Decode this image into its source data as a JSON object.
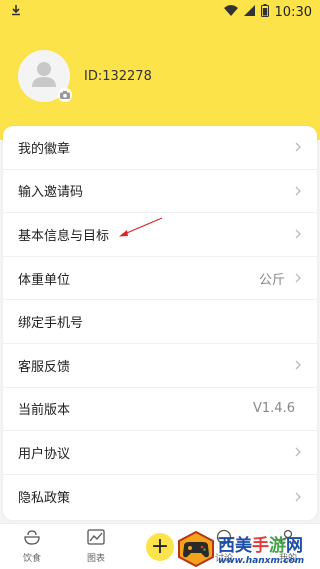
{
  "colors": {
    "accent": "#fce34a",
    "annotation": "#d9262c"
  },
  "status_bar": {
    "time": "10:30"
  },
  "profile": {
    "id_text": "ID:132278"
  },
  "menu": [
    {
      "label": "我的徽章",
      "value": ""
    },
    {
      "label": "输入邀请码",
      "value": ""
    },
    {
      "label": "基本信息与目标",
      "value": ""
    },
    {
      "label": "体重单位",
      "value": "公斤"
    },
    {
      "label": "绑定手机号",
      "value": ""
    },
    {
      "label": "客服反馈",
      "value": ""
    },
    {
      "label": "当前版本",
      "value": "V1.4.6"
    },
    {
      "label": "用户协议",
      "value": ""
    },
    {
      "label": "隐私政策",
      "value": ""
    }
  ],
  "tabbar": {
    "diet": "饮食",
    "chart": "图表",
    "add": "+",
    "discuss": "讨论",
    "mine": "我的"
  },
  "watermark": {
    "brand_parts": [
      "西",
      "美",
      "手",
      "游",
      "网"
    ],
    "url": "www.hanxm.com"
  }
}
